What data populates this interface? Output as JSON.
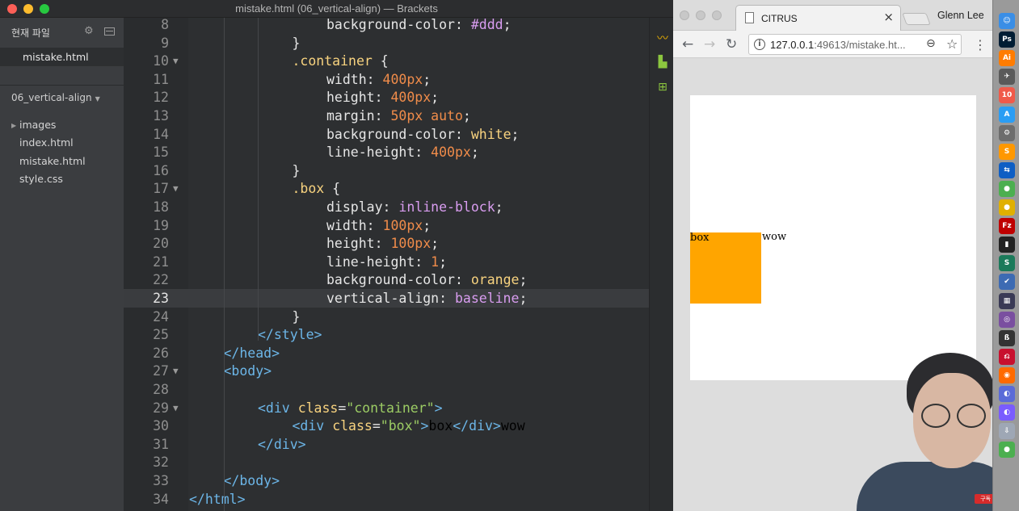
{
  "brackets": {
    "window_title": "mistake.html (06_vertical-align) — Brackets",
    "sidebar": {
      "working_files_header": "현재 파일",
      "working_files": [
        "mistake.html"
      ],
      "project_title": "06_vertical-align",
      "tree": [
        "images",
        "index.html",
        "mistake.html",
        "style.css"
      ]
    },
    "code": [
      {
        "n": "8",
        "fold": "",
        "text": "background-color: #ddd;"
      },
      {
        "n": "9",
        "fold": "",
        "text": "}"
      },
      {
        "n": "10",
        "fold": "▼",
        "text": ".container {"
      },
      {
        "n": "11",
        "fold": "",
        "text": "width: 400px;"
      },
      {
        "n": "12",
        "fold": "",
        "text": "height: 400px;"
      },
      {
        "n": "13",
        "fold": "",
        "text": "margin: 50px auto;"
      },
      {
        "n": "14",
        "fold": "",
        "text": "background-color: white;"
      },
      {
        "n": "15",
        "fold": "",
        "text": "line-height: 400px;"
      },
      {
        "n": "16",
        "fold": "",
        "text": "}"
      },
      {
        "n": "17",
        "fold": "▼",
        "text": ".box {"
      },
      {
        "n": "18",
        "fold": "",
        "text": "display: inline-block;"
      },
      {
        "n": "19",
        "fold": "",
        "text": "width: 100px;"
      },
      {
        "n": "20",
        "fold": "",
        "text": "height: 100px;"
      },
      {
        "n": "21",
        "fold": "",
        "text": "line-height: 1;"
      },
      {
        "n": "22",
        "fold": "",
        "text": "background-color: orange;"
      },
      {
        "n": "23",
        "fold": "",
        "text": "vertical-align: baseline;"
      },
      {
        "n": "24",
        "fold": "",
        "text": "}"
      },
      {
        "n": "25",
        "fold": "",
        "text": "</style>"
      },
      {
        "n": "26",
        "fold": "",
        "text": "</head>"
      },
      {
        "n": "27",
        "fold": "▼",
        "text": "<body>"
      },
      {
        "n": "28",
        "fold": "",
        "text": ""
      },
      {
        "n": "29",
        "fold": "▼",
        "text": "<div class=\"container\">"
      },
      {
        "n": "30",
        "fold": "",
        "text": "<div class=\"box\">box</div>wow"
      },
      {
        "n": "31",
        "fold": "",
        "text": "</div>"
      },
      {
        "n": "32",
        "fold": "",
        "text": ""
      },
      {
        "n": "33",
        "fold": "",
        "text": "</body>"
      },
      {
        "n": "34",
        "fold": "",
        "text": "</html>"
      }
    ],
    "current_line": "23"
  },
  "chrome": {
    "tab_title": "CITRUS",
    "profile_name": "Glenn Lee",
    "url_host": "127.0.0.1",
    "url_rest": ":49613/mistake.ht...",
    "page": {
      "box_text": "box",
      "trailing_text": "wow"
    }
  },
  "webcam": {
    "badge": "구독 & 알림"
  },
  "dock": {
    "icons": [
      "finder-icon",
      "photoshop-icon",
      "illustrator-icon",
      "launchpad-icon",
      "calendar-icon",
      "app-store-icon",
      "system-preferences-icon",
      "sublime-text-icon",
      "teamviewer-icon",
      "chrome-icon",
      "chrome-canary-icon",
      "filezilla-icon",
      "terminal-icon",
      "sourcetree-icon",
      "todo-icon",
      "screen-recorder-icon",
      "photo-booth-icon",
      "pandoc-icon",
      "acrobat-icon",
      "firefox-icon",
      "instruments-icon",
      "chrome-dev-icon",
      "downloads-icon",
      "chrome-beta-icon"
    ]
  }
}
